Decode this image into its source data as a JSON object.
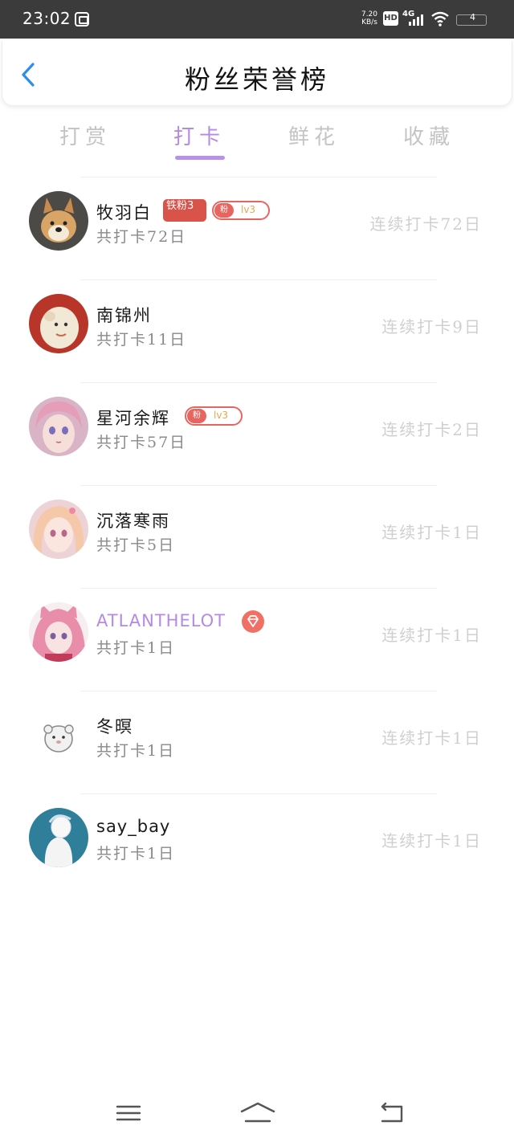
{
  "status_bar": {
    "time": "23:02",
    "speed_value": "7.20",
    "speed_unit": "KB/s",
    "hd": "HD",
    "network": "4G",
    "battery": "4"
  },
  "header": {
    "title": "粉丝荣誉榜",
    "back_icon": "chevron-left-icon"
  },
  "tabs": [
    {
      "label": "打赏",
      "active": false
    },
    {
      "label": "打卡",
      "active": true
    },
    {
      "label": "鲜花",
      "active": false
    },
    {
      "label": "收藏",
      "active": false
    }
  ],
  "items": [
    {
      "name": "牧羽白",
      "total": "共打卡72日",
      "streak": "连续打卡72日",
      "iron_badge": "铁粉3",
      "level_tag": "粉",
      "level": "lv3"
    },
    {
      "name": "南锦州",
      "total": "共打卡11日",
      "streak": "连续打卡9日"
    },
    {
      "name": "星河余辉",
      "total": "共打卡57日",
      "streak": "连续打卡2日",
      "level_tag": "粉",
      "level": "lv3"
    },
    {
      "name": "沉落寒雨",
      "total": "共打卡5日",
      "streak": "连续打卡1日"
    },
    {
      "name": "ATLANTHELOT",
      "total": "共打卡1日",
      "streak": "连续打卡1日",
      "vip_badge": "diamond-icon"
    },
    {
      "name": "冬暝",
      "total": "共打卡1日",
      "streak": "连续打卡1日"
    },
    {
      "name": "say_bay",
      "total": "共打卡1日",
      "streak": "连续打卡1日"
    }
  ],
  "colors": {
    "accent": "#b48be0",
    "badge_red": "#d9534a",
    "level_border": "#e8655f",
    "muted_text": "#cfcfcf"
  },
  "nav_bar": {
    "menu_icon": "menu-icon",
    "home_icon": "home-icon",
    "back_icon": "back-icon"
  }
}
